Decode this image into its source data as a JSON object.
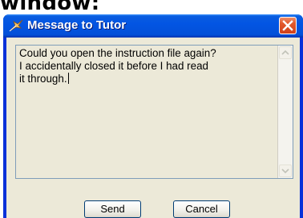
{
  "background_caption": "window:",
  "dialog": {
    "title": "Message to Tutor",
    "title_icon": "feather-pen-icon",
    "close_icon": "close-icon",
    "message_lines": [
      "Could you open the instruction file again?",
      "I accidentally closed it before I had read",
      "it through."
    ],
    "buttons": {
      "send": "Send",
      "cancel": "Cancel"
    }
  },
  "colors": {
    "titlebar": "#0355e3",
    "client": "#ece9d8",
    "close_button": "#d0401a",
    "title_text": "#ffffff"
  }
}
